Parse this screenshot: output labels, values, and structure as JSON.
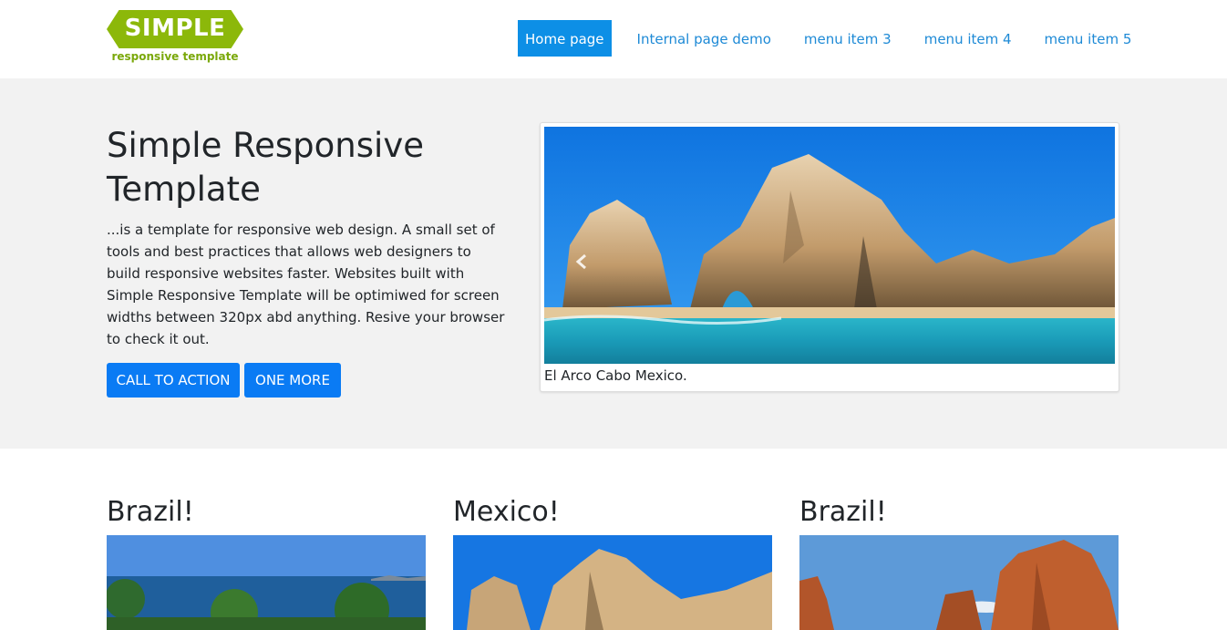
{
  "logo": {
    "title": "SIMPLE",
    "subtitle": "responsive template",
    "color": "#8cb80a"
  },
  "nav": {
    "items": [
      {
        "label": "Home page",
        "active": true
      },
      {
        "label": "Internal page demo",
        "active": false
      },
      {
        "label": "menu item 3",
        "active": false
      },
      {
        "label": "menu item 4",
        "active": false
      },
      {
        "label": "menu item 5",
        "active": false
      }
    ]
  },
  "hero": {
    "title": "Simple Responsive Template",
    "text": "...is a template for responsive web design. A small set of tools and best practices that allows web designers to build responsive websites faster. Websites built with Simple Responsive Template will be optimiwed for screen widths between 320px abd anything. Resive your browser to check it out.",
    "buttons": [
      "CALL TO ACTION",
      "ONE MORE"
    ],
    "image_caption": "El Arco Cabo Mexico.",
    "prev_icon": "chevron-left-icon"
  },
  "cards": [
    {
      "title": "Brazil!"
    },
    {
      "title": "Mexico!"
    },
    {
      "title": "Brazil!"
    }
  ],
  "colors": {
    "accent": "#0a7bf4",
    "nav_active": "#0d8fe6",
    "nav_link": "#1e8ad6",
    "hero_bg": "#f2f2f2"
  }
}
